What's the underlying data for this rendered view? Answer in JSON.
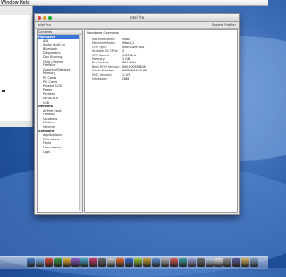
{
  "menubar": {
    "window": "Window",
    "help": "Help"
  },
  "window": {
    "title": "Intel Pro"
  },
  "toolbar": {
    "left": "Intel Pro",
    "right": "System Profiler"
  },
  "sidebar": {
    "header": "Contents",
    "rows": [
      {
        "label": "Hardware",
        "kind": "cat",
        "selected": true
      },
      {
        "label": "ATA",
        "kind": "item"
      },
      {
        "label": "Audio (built in)",
        "kind": "item"
      },
      {
        "label": "Bluetooth",
        "kind": "item"
      },
      {
        "label": "Diagnostics",
        "kind": "item"
      },
      {
        "label": "Disc Burning",
        "kind": "item"
      },
      {
        "label": "Fibre Channel",
        "kind": "item"
      },
      {
        "label": "FireWire",
        "kind": "item"
      },
      {
        "label": "Graphics/Displays",
        "kind": "item"
      },
      {
        "label": "Memory",
        "kind": "item"
      },
      {
        "label": "PC Cards",
        "kind": "item"
      },
      {
        "label": "PCI Cards",
        "kind": "item"
      },
      {
        "label": "Parallel SCSI",
        "kind": "item"
      },
      {
        "label": "Power",
        "kind": "item"
      },
      {
        "label": "Printers",
        "kind": "item"
      },
      {
        "label": "Serial-ATA",
        "kind": "item"
      },
      {
        "label": "USB",
        "kind": "item"
      },
      {
        "label": "Network",
        "kind": "cat"
      },
      {
        "label": "AirPort Card",
        "kind": "item"
      },
      {
        "label": "Firewall",
        "kind": "item"
      },
      {
        "label": "Locations",
        "kind": "item"
      },
      {
        "label": "Modems",
        "kind": "item"
      },
      {
        "label": "Volumes",
        "kind": "item"
      },
      {
        "label": "Software",
        "kind": "cat"
      },
      {
        "label": "Applications",
        "kind": "item"
      },
      {
        "label": "Extensions",
        "kind": "item"
      },
      {
        "label": "Fonts",
        "kind": "item"
      },
      {
        "label": "Frameworks",
        "kind": "item"
      },
      {
        "label": "Logs",
        "kind": "item"
      }
    ]
  },
  "detail": {
    "heading": "Hardware Overview:",
    "rows": [
      {
        "key": "Machine Name:",
        "value": "iMac"
      },
      {
        "key": "Machine Model:",
        "value": "iMac4,1"
      },
      {
        "key": "CPU Type:",
        "value": "Intel Core Duo"
      },
      {
        "key": "Number Of CPUs:",
        "value": "2"
      },
      {
        "key": "CPU Speed:",
        "value": "1.83 GHz"
      },
      {
        "key": "Memory:",
        "value": "1 GB"
      },
      {
        "key": "Bus Speed:",
        "value": "667 MHz"
      },
      {
        "key": "Boot ROM Version:",
        "value": "IM41.0055.B08"
      },
      {
        "key": "Serial Number:",
        "value": "W8608A4UVUW"
      },
      {
        "key": "SMC Version:",
        "value": "1.1f5"
      },
      {
        "key": "Hardware:",
        "value": "i386"
      }
    ]
  },
  "colors": {
    "selection": "#3875d7",
    "desktop": "#2a5aa5"
  }
}
